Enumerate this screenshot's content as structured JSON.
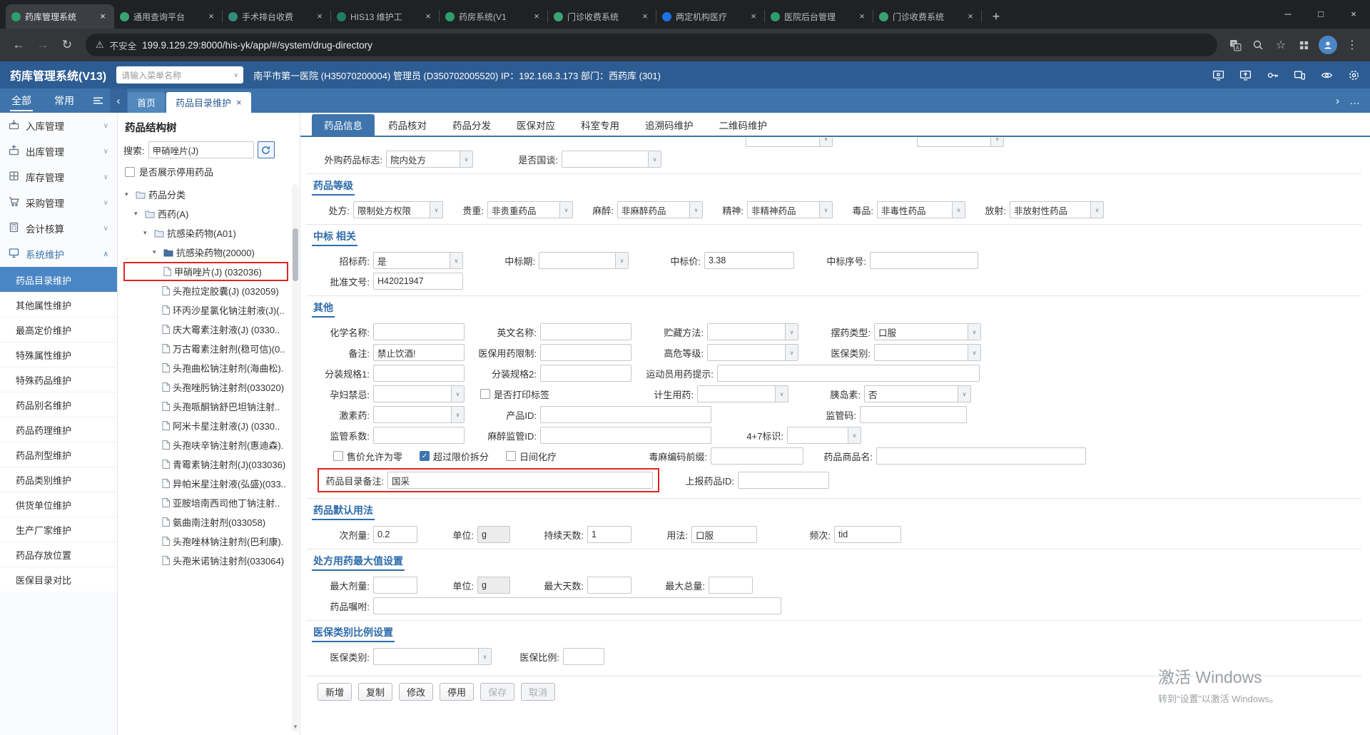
{
  "colors": {
    "brand_header": "#2d5c92",
    "brand_nav": "#3e74ab",
    "brand_active": "#4a86c5",
    "section_title_blue": "#2e6cab",
    "highlight_red": "#e02525"
  },
  "browser": {
    "tabs": [
      {
        "label": "药库管理系统",
        "active": true,
        "favicon": "#2e9e6b"
      },
      {
        "label": "通用查询平台",
        "active": false,
        "favicon": "#39a374"
      },
      {
        "label": "手术排台收费",
        "active": false,
        "favicon": "#2f8f7a"
      },
      {
        "label": "HIS13 维护工",
        "active": false,
        "favicon": "#1d7f5f"
      },
      {
        "label": "药房系统(V1",
        "active": false,
        "favicon": "#2e9e6b"
      },
      {
        "label": "门诊收费系统",
        "active": false,
        "favicon": "#39a374"
      },
      {
        "label": "两定机构医疗",
        "active": false,
        "favicon": "#1a73e8"
      },
      {
        "label": "医院后台管理",
        "active": false,
        "favicon": "#2e9e6b"
      },
      {
        "label": "门诊收费系统",
        "active": false,
        "favicon": "#39a374"
      }
    ],
    "new_tab_label": "+",
    "window_controls": [
      {
        "name": "minimize-icon",
        "glyph": "─"
      },
      {
        "name": "maximize-icon",
        "glyph": "□"
      },
      {
        "name": "close-icon",
        "glyph": "×"
      }
    ],
    "security_label": "不安全",
    "url": "199.9.129.29:8000/his-yk/app/#/system/drug-directory"
  },
  "app_header": {
    "title": "药库管理系统(V13)",
    "search_placeholder": "请输入菜单名称",
    "org_info": "南平市第一医院 (H35070200004) 管理员 (D350702005520) IP：192.168.3.173 部门：西药库 (301)"
  },
  "navbar": {
    "filter_all": "全部",
    "filter_common": "常用",
    "page_tabs": [
      {
        "label": "首页",
        "active": false,
        "closable": false
      },
      {
        "label": "药品目录维护",
        "active": true,
        "closable": true
      }
    ]
  },
  "sidebar": {
    "groups": [
      {
        "label": "入库管理",
        "icon": "inbound-icon",
        "expanded": false
      },
      {
        "label": "出库管理",
        "icon": "outbound-icon",
        "expanded": false
      },
      {
        "label": "库存管理",
        "icon": "inventory-icon",
        "expanded": false
      },
      {
        "label": "采购管理",
        "icon": "purchase-icon",
        "expanded": false
      },
      {
        "label": "会计核算",
        "icon": "accounting-icon",
        "expanded": false
      },
      {
        "label": "系统维护",
        "icon": "system-icon",
        "expanded": true
      }
    ],
    "system_children": [
      {
        "label": "药品目录维护",
        "active": true
      },
      {
        "label": "其他属性维护"
      },
      {
        "label": "最高定价维护"
      },
      {
        "label": "特殊属性维护"
      },
      {
        "label": "特殊药品维护"
      },
      {
        "label": "药品别名维护"
      },
      {
        "label": "药品药理维护"
      },
      {
        "label": "药品剂型维护"
      },
      {
        "label": "药品类别维护"
      },
      {
        "label": "供货单位维护"
      },
      {
        "label": "生产厂家维护"
      },
      {
        "label": "药品存放位置"
      },
      {
        "label": "医保目录对比"
      }
    ]
  },
  "tree": {
    "title": "药品结构树",
    "search_label": "搜索:",
    "search_value": "甲硝唑片(J)",
    "show_disabled": {
      "label": "是否展示停用药品",
      "checked": false
    },
    "nodes": [
      {
        "label": "药品分类",
        "level": 0,
        "kind": "folder"
      },
      {
        "label": "西药(A)",
        "level": 1,
        "kind": "folder"
      },
      {
        "label": "抗感染药物(A01)",
        "level": 2,
        "kind": "folder"
      },
      {
        "label": "抗感染药物(20000)",
        "level": 3,
        "kind": "tag"
      },
      {
        "label": "甲硝唑片(J)  (032036)",
        "level": 4,
        "kind": "leaf",
        "selected": true
      },
      {
        "label": "头孢拉定胶囊(J)  (032059)",
        "level": 4,
        "kind": "leaf"
      },
      {
        "label": "环丙沙星氯化钠注射液(J)(..",
        "level": 4,
        "kind": "leaf"
      },
      {
        "label": "庆大霉素注射液(J)  (0330..",
        "level": 4,
        "kind": "leaf"
      },
      {
        "label": "万古霉素注射剂(稳可信)(0..",
        "level": 4,
        "kind": "leaf"
      },
      {
        "label": "头孢曲松钠注射剂(海曲松).",
        "level": 4,
        "kind": "leaf"
      },
      {
        "label": "头孢唑肟钠注射剂(033020)",
        "level": 4,
        "kind": "leaf"
      },
      {
        "label": "头孢哌酮钠舒巴坦钠注射..",
        "level": 4,
        "kind": "leaf"
      },
      {
        "label": "阿米卡星注射液(J)  (0330..",
        "level": 4,
        "kind": "leaf"
      },
      {
        "label": "头孢呋辛钠注射剂(惠迪森).",
        "level": 4,
        "kind": "leaf"
      },
      {
        "label": "青霉素钠注射剂(J)(033036)",
        "level": 4,
        "kind": "leaf"
      },
      {
        "label": "异帕米星注射液(弘盛)(033..",
        "level": 4,
        "kind": "leaf"
      },
      {
        "label": "亚胺培南西司他丁钠注射..",
        "level": 4,
        "kind": "leaf"
      },
      {
        "label": "氨曲南注射剂(033058)",
        "level": 4,
        "kind": "leaf"
      },
      {
        "label": "头孢唑林钠注射剂(巴利康).",
        "level": 4,
        "kind": "leaf"
      },
      {
        "label": "头孢米诺钠注射剂(033064)",
        "level": 4,
        "kind": "leaf"
      }
    ]
  },
  "content": {
    "tabs": [
      {
        "label": "药品信息",
        "active": true
      },
      {
        "label": "药品核对"
      },
      {
        "label": "药品分发"
      },
      {
        "label": "医保对应"
      },
      {
        "label": "科室专用"
      },
      {
        "label": "追溯码维护"
      },
      {
        "label": "二维码维护"
      }
    ]
  },
  "form": {
    "sections": [
      {
        "title": "",
        "rows": [
          {
            "clip": true,
            "fields": [
              {
                "type": "select",
                "value": "",
                "cw": 122,
                "ml": 600
              },
              {
                "type": "select",
                "value": "",
                "cw": 122,
                "ml": 118
              }
            ]
          },
          {
            "fields": [
              {
                "type": "select",
                "label": "外购药品标志:",
                "value": "院内处方",
                "lw": 96,
                "cw": 122
              },
              {
                "type": "select",
                "label": "是否国谈:",
                "value": "",
                "lw": 96,
                "cw": 140,
                "ml": 28
              }
            ]
          }
        ]
      },
      {
        "title": "药品等级",
        "rows": [
          {
            "fields": [
              {
                "type": "select",
                "label": "处方:",
                "value": "限制处方权限",
                "lw": 50,
                "cw": 126
              },
              {
                "type": "select",
                "label": "贵重:",
                "value": "非贵重药品",
                "lw": 46,
                "cw": 120,
                "ml": 16
              },
              {
                "type": "select",
                "label": "麻醉:",
                "value": "非麻醉药品",
                "lw": 46,
                "cw": 120,
                "ml": 16
              },
              {
                "type": "select",
                "label": "精神:",
                "value": "非精神药品",
                "lw": 46,
                "cw": 120,
                "ml": 16
              },
              {
                "type": "select",
                "label": "毒品:",
                "value": "非毒性药品",
                "lw": 46,
                "cw": 124,
                "ml": 16
              },
              {
                "type": "select",
                "label": "放射:",
                "value": "非放射性药品",
                "lw": 46,
                "cw": 132,
                "ml": 16
              }
            ]
          }
        ]
      },
      {
        "title": "中标 相关",
        "rows": [
          {
            "fields": [
              {
                "type": "select",
                "label": "招标药:",
                "value": "是",
                "lw": 78,
                "cw": 126
              },
              {
                "type": "select",
                "label": "中标期:",
                "value": "",
                "lw": 92,
                "cw": 126,
                "ml": 14
              },
              {
                "type": "input",
                "label": "中标价:",
                "value": "3.38",
                "lw": 92,
                "cw": 126,
                "ml": 14
              },
              {
                "type": "input",
                "label": "中标序号:",
                "value": "",
                "lw": 92,
                "cw": 152,
                "ml": 14
              }
            ]
          },
          {
            "fields": [
              {
                "type": "input",
                "label": "批准文号:",
                "value": "H42021947",
                "lw": 78,
                "cw": 126
              }
            ]
          }
        ]
      },
      {
        "title": "其他",
        "rows": [
          {
            "fields": [
              {
                "type": "input",
                "label": "化学名称:",
                "value": "",
                "lw": 78,
                "cw": 128
              },
              {
                "type": "input",
                "label": "英文名称:",
                "value": "",
                "lw": 92,
                "cw": 128,
                "ml": 14
              },
              {
                "type": "select",
                "label": "贮藏方法:",
                "value": "",
                "lw": 92,
                "cw": 128,
                "ml": 14
              },
              {
                "type": "select",
                "label": "摆药类型:",
                "value": "口服",
                "lw": 92,
                "cw": 150,
                "ml": 14
              }
            ]
          },
          {
            "fields": [
              {
                "type": "input",
                "label": "备注:",
                "value": "禁止饮酒!",
                "lw": 78,
                "cw": 128
              },
              {
                "type": "input",
                "label": "医保用药限制:",
                "value": "",
                "lw": 92,
                "cw": 128,
                "ml": 14
              },
              {
                "type": "select",
                "label": "高危等级:",
                "value": "",
                "lw": 92,
                "cw": 128,
                "ml": 14
              },
              {
                "type": "select",
                "label": "医保类别:",
                "value": "",
                "lw": 92,
                "cw": 150,
                "ml": 14
              }
            ]
          },
          {
            "fields": [
              {
                "type": "input",
                "label": "分装规格1:",
                "value": "",
                "lw": 78,
                "cw": 128
              },
              {
                "type": "input",
                "label": "分装规格2:",
                "value": "",
                "lw": 92,
                "cw": 128,
                "ml": 14
              },
              {
                "type": "input",
                "label": "运动员用药提示:",
                "value": "",
                "lw": 106,
                "cw": 368,
                "ml": 14
              }
            ]
          },
          {
            "fields": [
              {
                "type": "select",
                "label": "孕妇禁忌:",
                "value": "",
                "lw": 78,
                "cw": 128
              },
              {
                "type": "checkbox",
                "label": "是否打印标签",
                "checked": false,
                "ml": 22,
                "cellw": 212
              },
              {
                "type": "select",
                "label": "计生用药:",
                "value": "",
                "lw": 92,
                "cw": 128
              },
              {
                "type": "select",
                "label": "胰岛素:",
                "value": "否",
                "lw": 92,
                "cw": 150,
                "ml": 14
              }
            ]
          },
          {
            "fields": [
              {
                "type": "select",
                "label": "激素药:",
                "value": "",
                "lw": 78,
                "cw": 128
              },
              {
                "type": "input",
                "label": "产品ID:",
                "value": "",
                "lw": 92,
                "cw": 240,
                "ml": 14
              },
              {
                "type": "input",
                "label": "监管码:",
                "value": "",
                "lw": 92,
                "cw": 150,
                "ml": 116
              }
            ]
          },
          {
            "fields": [
              {
                "type": "input",
                "label": "监管系数:",
                "value": "",
                "lw": 78,
                "cw": 128
              },
              {
                "type": "input",
                "label": "麻醉监管ID:",
                "value": "",
                "lw": 92,
                "cw": 240,
                "ml": 14
              },
              {
                "type": "select",
                "label": "4+7标识:",
                "value": "",
                "lw": 92,
                "cw": 104,
                "ml": 14
              }
            ]
          },
          {
            "fields": [
              {
                "type": "checkbox",
                "label": "售价允许为零",
                "checked": false,
                "ml": 22
              },
              {
                "type": "checkbox",
                "label": "超过限价拆分",
                "checked": true,
                "ml": 24
              },
              {
                "type": "checkbox",
                "label": "日间化疗",
                "checked": false,
                "ml": 24
              },
              {
                "type": "input",
                "label": "毒麻编码前缀:",
                "value": "",
                "lw": 112,
                "cw": 130,
                "ml": 104
              },
              {
                "type": "input",
                "label": "药品商品名:",
                "value": "",
                "lw": 88,
                "cw": 294,
                "ml": 14
              }
            ]
          },
          {
            "fields": [
              {
                "type": "input",
                "label": "药品目录备注:",
                "value": "国采",
                "lw": 92,
                "cw": 372,
                "boxed": true
              },
              {
                "type": "input",
                "label": "上报药品ID:",
                "value": "",
                "lw": 92,
                "cw": 128,
                "ml": 18
              }
            ]
          }
        ]
      },
      {
        "title": "药品默认用法",
        "rows": [
          {
            "fields": [
              {
                "type": "input",
                "label": "次剂量:",
                "value": "0.2",
                "lw": 78,
                "cw": 62
              },
              {
                "type": "input",
                "label": "单位:",
                "value": "g",
                "lw": 58,
                "cw": 46,
                "muted": true,
                "ml": 26
              },
              {
                "type": "input",
                "label": "持续天数:",
                "value": "1",
                "lw": 82,
                "cw": 62,
                "ml": 26
              },
              {
                "type": "input",
                "label": "用法:",
                "value": "口服",
                "lw": 58,
                "cw": 92,
                "ml": 26
              },
              {
                "type": "input",
                "label": "频次:",
                "value": "tid",
                "lw": 58,
                "cw": 94,
                "ml": 50
              }
            ]
          }
        ]
      },
      {
        "title": "处方用药最大值设置",
        "rows": [
          {
            "fields": [
              {
                "type": "input",
                "label": "最大剂量:",
                "value": "",
                "lw": 78,
                "cw": 62
              },
              {
                "type": "input",
                "label": "单位:",
                "value": "g",
                "lw": 58,
                "cw": 46,
                "muted": true,
                "ml": 26
              },
              {
                "type": "input",
                "label": "最大天数:",
                "value": "",
                "lw": 82,
                "cw": 62,
                "ml": 26
              },
              {
                "type": "input",
                "label": "最大总量:",
                "value": "",
                "lw": 82,
                "cw": 62,
                "ml": 26
              }
            ]
          },
          {
            "fields": [
              {
                "type": "input",
                "label": "药品嘱咐:",
                "value": "",
                "lw": 78,
                "cw": 572
              }
            ]
          }
        ]
      },
      {
        "title": "医保类别比例设置",
        "rows": [
          {
            "fields": [
              {
                "type": "select",
                "label": "医保类别:",
                "value": "",
                "lw": 78,
                "cw": 166
              },
              {
                "type": "input",
                "label": "医保比例:",
                "value": "",
                "lw": 82,
                "cw": 58,
                "ml": 18
              }
            ]
          }
        ]
      }
    ],
    "buttons": [
      {
        "label": "新增",
        "name": "add-button",
        "enabled": true
      },
      {
        "label": "复制",
        "name": "copy-button",
        "enabled": true
      },
      {
        "label": "修改",
        "name": "modify-button",
        "enabled": true
      },
      {
        "label": "停用",
        "name": "disable-button",
        "enabled": true
      },
      {
        "label": "保存",
        "name": "save-button",
        "enabled": false
      },
      {
        "label": "取消",
        "name": "cancel-button",
        "enabled": false
      }
    ]
  },
  "watermark": {
    "title": "激活 Windows",
    "subtitle": "转到“设置”以激活 Windows。"
  }
}
